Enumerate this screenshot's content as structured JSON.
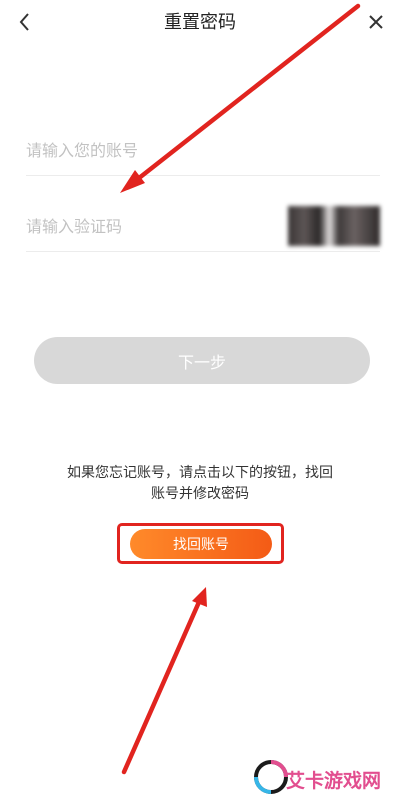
{
  "header": {
    "title": "重置密码",
    "back_icon": "chevron-left-icon",
    "close_icon": "close-icon"
  },
  "form": {
    "account_placeholder": "请输入您的账号",
    "account_value": "",
    "code_placeholder": "请输入验证码",
    "code_value": ""
  },
  "next_button_label": "下一步",
  "hint": {
    "line1": "如果您忘记账号，请点击以下的按钮，找回",
    "line2": "账号并修改密码"
  },
  "recover_button_label": "找回账号",
  "watermark": {
    "text": "艾卡游戏网"
  },
  "colors": {
    "annotation": "#e1241f",
    "recover_button": "#f45b16",
    "disabled_button": "#d8d8d8"
  }
}
